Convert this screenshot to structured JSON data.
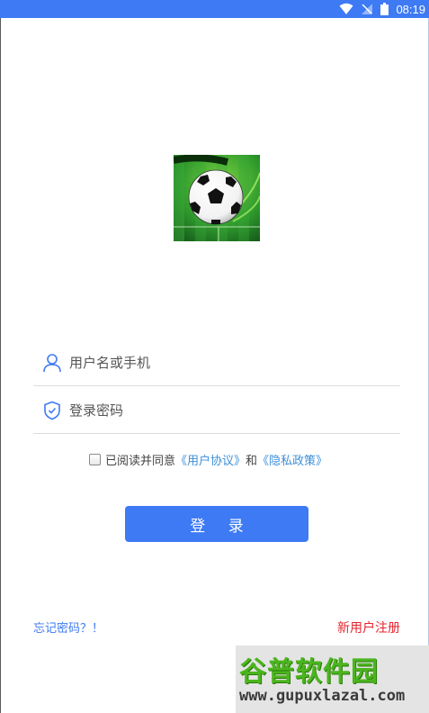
{
  "status_bar": {
    "time": "08:19",
    "background": "#3d7af4",
    "icons": [
      "wifi-icon",
      "signal-off-icon",
      "battery-icon"
    ]
  },
  "logo": {
    "icon": "soccer-ball-on-pitch-logo"
  },
  "login_form": {
    "username": {
      "placeholder": "用户名或手机",
      "icon": "user-icon"
    },
    "password": {
      "placeholder": "登录密码",
      "icon": "shield-check-icon"
    },
    "agreement": {
      "checked": false,
      "prefix": "已阅读并同意",
      "user_agreement": "《用户协议》",
      "conjunction": "和",
      "privacy_policy": "《隐私政策》"
    },
    "login_button": "登 录"
  },
  "footer": {
    "forgot_password": "忘记密码？！",
    "register": "新用户注册"
  },
  "watermark": {
    "title": "谷普软件园",
    "url": "www.gupuxlazal.com"
  },
  "colors": {
    "primary": "#3d7af4",
    "link": "#3d8fd8",
    "register": "#e8232e",
    "watermark_green": "#4bb51e"
  }
}
